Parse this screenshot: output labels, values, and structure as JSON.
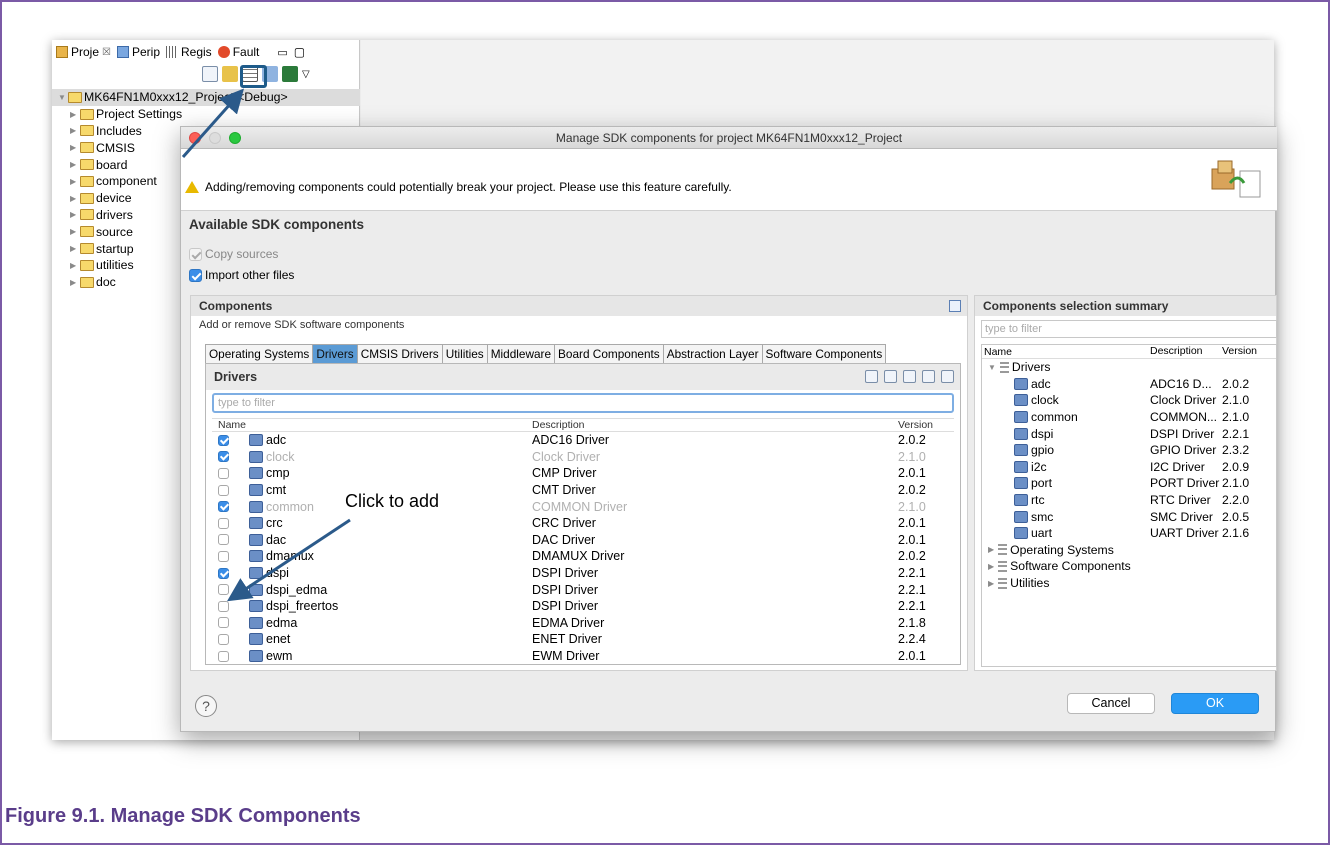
{
  "eclipse": {
    "view_tabs": [
      {
        "label": "Proje",
        "icon": "project-explorer-icon",
        "closable": true
      },
      {
        "label": "Perip",
        "icon": "peripherals-icon"
      },
      {
        "label": "Regis",
        "icon": "registers-icon"
      },
      {
        "label": "Fault",
        "icon": "fault-icon"
      }
    ],
    "close_glyph": "☒",
    "project_tree": {
      "root": "MK64FN1M0xxx12_Project <Debug>",
      "items": [
        {
          "label": "Project Settings",
          "icon": "settings-icon"
        },
        {
          "label": "Includes",
          "icon": "includes-icon"
        },
        {
          "label": "CMSIS",
          "icon": "folder-icon"
        },
        {
          "label": "board",
          "icon": "folder-icon"
        },
        {
          "label": "component",
          "icon": "folder-icon"
        },
        {
          "label": "device",
          "icon": "folder-icon"
        },
        {
          "label": "drivers",
          "icon": "folder-icon"
        },
        {
          "label": "source",
          "icon": "folder-icon"
        },
        {
          "label": "startup",
          "icon": "folder-icon"
        },
        {
          "label": "utilities",
          "icon": "folder-icon"
        },
        {
          "label": "doc",
          "icon": "folder-icon"
        }
      ]
    }
  },
  "dialog": {
    "title": "Manage SDK components for project MK64FN1M0xxx12_Project",
    "warning": "Adding/removing components could potentially break your project. Please use this feature carefully.",
    "section_title": "Available SDK components",
    "options": [
      {
        "label": "Copy sources",
        "checked": true,
        "disabled": true
      },
      {
        "label": "Import other files",
        "checked": true,
        "disabled": false
      }
    ],
    "components": {
      "title": "Components",
      "subtitle": "Add or remove SDK software components",
      "tabs": [
        "Operating Systems",
        "Drivers",
        "CMSIS Drivers",
        "Utilities",
        "Middleware",
        "Board Components",
        "Abstraction Layer",
        "Software Components"
      ],
      "active_tab": "Drivers",
      "drivers_title": "Drivers",
      "filter_placeholder": "type to filter",
      "columns": {
        "name": "Name",
        "description": "Description",
        "version": "Version"
      },
      "rows": [
        {
          "name": "adc",
          "description": "ADC16 Driver",
          "version": "2.0.2",
          "checked": true,
          "greyed": false
        },
        {
          "name": "clock",
          "description": "Clock Driver",
          "version": "2.1.0",
          "checked": true,
          "greyed": true
        },
        {
          "name": "cmp",
          "description": "CMP Driver",
          "version": "2.0.1",
          "checked": false,
          "greyed": false
        },
        {
          "name": "cmt",
          "description": "CMT Driver",
          "version": "2.0.2",
          "checked": false,
          "greyed": false
        },
        {
          "name": "common",
          "description": "COMMON Driver",
          "version": "2.1.0",
          "checked": true,
          "greyed": true
        },
        {
          "name": "crc",
          "description": "CRC Driver",
          "version": "2.0.1",
          "checked": false,
          "greyed": false
        },
        {
          "name": "dac",
          "description": "DAC Driver",
          "version": "2.0.1",
          "checked": false,
          "greyed": false
        },
        {
          "name": "dmamux",
          "description": "DMAMUX Driver",
          "version": "2.0.2",
          "checked": false,
          "greyed": false
        },
        {
          "name": "dspi",
          "description": "DSPI Driver",
          "version": "2.2.1",
          "checked": true,
          "greyed": false
        },
        {
          "name": "dspi_edma",
          "description": "DSPI Driver",
          "version": "2.2.1",
          "checked": false,
          "greyed": false
        },
        {
          "name": "dspi_freertos",
          "description": "DSPI Driver",
          "version": "2.2.1",
          "checked": false,
          "greyed": false
        },
        {
          "name": "edma",
          "description": "EDMA Driver",
          "version": "2.1.8",
          "checked": false,
          "greyed": false
        },
        {
          "name": "enet",
          "description": "ENET Driver",
          "version": "2.2.4",
          "checked": false,
          "greyed": false
        },
        {
          "name": "ewm",
          "description": "EWM Driver",
          "version": "2.0.1",
          "checked": false,
          "greyed": false
        }
      ]
    },
    "summary": {
      "title": "Components selection summary",
      "filter_placeholder": "type to filter",
      "columns": {
        "name": "Name",
        "description": "Description",
        "version": "Version"
      },
      "group": "Drivers",
      "items": [
        {
          "name": "adc",
          "description": "ADC16 D...",
          "version": "2.0.2"
        },
        {
          "name": "clock",
          "description": "Clock Driver",
          "version": "2.1.0"
        },
        {
          "name": "common",
          "description": "COMMON...",
          "version": "2.1.0"
        },
        {
          "name": "dspi",
          "description": "DSPI Driver",
          "version": "2.2.1"
        },
        {
          "name": "gpio",
          "description": "GPIO Driver",
          "version": "2.3.2"
        },
        {
          "name": "i2c",
          "description": "I2C Driver",
          "version": "2.0.9"
        },
        {
          "name": "port",
          "description": "PORT Driver",
          "version": "2.1.0"
        },
        {
          "name": "rtc",
          "description": "RTC Driver",
          "version": "2.2.0"
        },
        {
          "name": "smc",
          "description": "SMC Driver",
          "version": "2.0.5"
        },
        {
          "name": "uart",
          "description": "UART Driver",
          "version": "2.1.6"
        }
      ],
      "collapsed_groups": [
        "Operating Systems",
        "Software Components",
        "Utilities"
      ]
    },
    "help": "?",
    "cancel": "Cancel",
    "ok": "OK"
  },
  "annotation": "Click to add",
  "caption": "Figure 9.1. Manage SDK Components",
  "colors": {
    "accent": "#2a9bf5",
    "caption": "#5a3d8a",
    "frame": "#7b5aa6",
    "highlight": "#1e5b8a"
  }
}
